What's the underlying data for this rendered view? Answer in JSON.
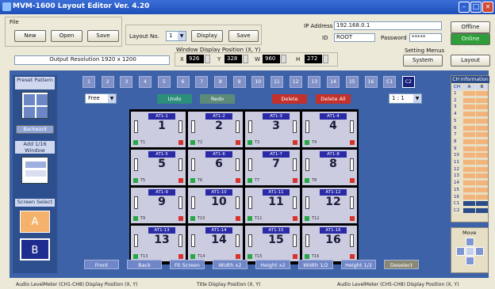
{
  "window": {
    "title": "MVM-1600 Layout Editor  Ver. 4.20"
  },
  "file": {
    "group_label": "File",
    "new_label": "New",
    "open_label": "Open",
    "save_label": "Save"
  },
  "layout": {
    "label": "Layout No.",
    "value": "1",
    "display_label": "Display",
    "save_label": "Save"
  },
  "network": {
    "ip_label": "IP Address",
    "ip_value": "192.168.0.1",
    "id_label": "ID",
    "id_value": "ROOT",
    "password_label": "Password",
    "password_value": "*****"
  },
  "status": {
    "offline_label": "Offline",
    "online_editing_label": "Online Editing"
  },
  "position": {
    "title": "Window Display Position (X, Y)",
    "x_label": "X",
    "x_value": "926",
    "y_label": "Y",
    "y_value": "328",
    "w_label": "W",
    "w_value": "960",
    "h_label": "H",
    "h_value": "272"
  },
  "output_resolution": "Output Resolution 1920 x 1200",
  "setting": {
    "menu_label": "Setting Menus",
    "system_label": "System",
    "layout_label": "Layout"
  },
  "preset": {
    "title": "Preset Pattern",
    "backward_label": "Backward",
    "add_label": "Add 1/16 Window"
  },
  "screen_select": {
    "title": "Screen Select",
    "a_label": "A",
    "b_label": "B"
  },
  "tiles": [
    "1",
    "2",
    "3",
    "4",
    "5",
    "6",
    "7",
    "8",
    "9",
    "10",
    "11",
    "12",
    "13",
    "14",
    "15",
    "16",
    "C1",
    "C2"
  ],
  "controls": {
    "mode_value": "Free",
    "undo_label": "Undo",
    "redo_label": "Redo",
    "delete_label": "Delete",
    "delete_all_label": "Delete All",
    "ratio_value": "1 : 1"
  },
  "cells": [
    {
      "title": "AT1-1",
      "num": "1",
      "tag": "T1"
    },
    {
      "title": "AT1-2",
      "num": "2",
      "tag": "T2"
    },
    {
      "title": "AT1-3",
      "num": "3",
      "tag": "T3"
    },
    {
      "title": "AT1-4",
      "num": "4",
      "tag": "T4"
    },
    {
      "title": "AT1-5",
      "num": "5",
      "tag": "T5"
    },
    {
      "title": "AT1-6",
      "num": "6",
      "tag": "T6"
    },
    {
      "title": "AT1-7",
      "num": "7",
      "tag": "T7"
    },
    {
      "title": "AT1-8",
      "num": "8",
      "tag": "T8"
    },
    {
      "title": "AT1-9",
      "num": "9",
      "tag": "T9"
    },
    {
      "title": "AT1-10",
      "num": "10",
      "tag": "T10"
    },
    {
      "title": "AT1-11",
      "num": "11",
      "tag": "T11"
    },
    {
      "title": "AT1-12",
      "num": "12",
      "tag": "T12"
    },
    {
      "title": "AT1-13",
      "num": "13",
      "tag": "T13"
    },
    {
      "title": "AT1-14",
      "num": "14",
      "tag": "T14"
    },
    {
      "title": "AT1-15",
      "num": "15",
      "tag": "T15"
    },
    {
      "title": "AT1-16",
      "num": "16",
      "tag": "T16"
    }
  ],
  "bottom_buttons": [
    "Front",
    "Back",
    "Fit Screen",
    "Width x2",
    "Height x2",
    "Width 1/2",
    "Height 1/2",
    "Deselect"
  ],
  "ch_info": {
    "title": "CH Information",
    "col_ch": "CH",
    "col_a": "A",
    "col_b": "B",
    "rows": [
      "1",
      "2",
      "3",
      "4",
      "5",
      "6",
      "7",
      "8",
      "9",
      "10",
      "11",
      "12",
      "13",
      "14",
      "15",
      "16",
      "C1",
      "C2"
    ]
  },
  "move_label": "Move",
  "footer": {
    "left": "Audio LevelMeter (CH1-CH8) Display Position (X, Y)",
    "middle": "Title Display Position (X, Y)",
    "right": "Audio LevelMeter (CH5-CH8) Display Position (X, Y)"
  },
  "colors": {
    "accent_blue": "#3d62a8",
    "online_green": "#2f9e3a",
    "delete_red": "#c3312b",
    "undo_teal": "#2b8f7a"
  }
}
